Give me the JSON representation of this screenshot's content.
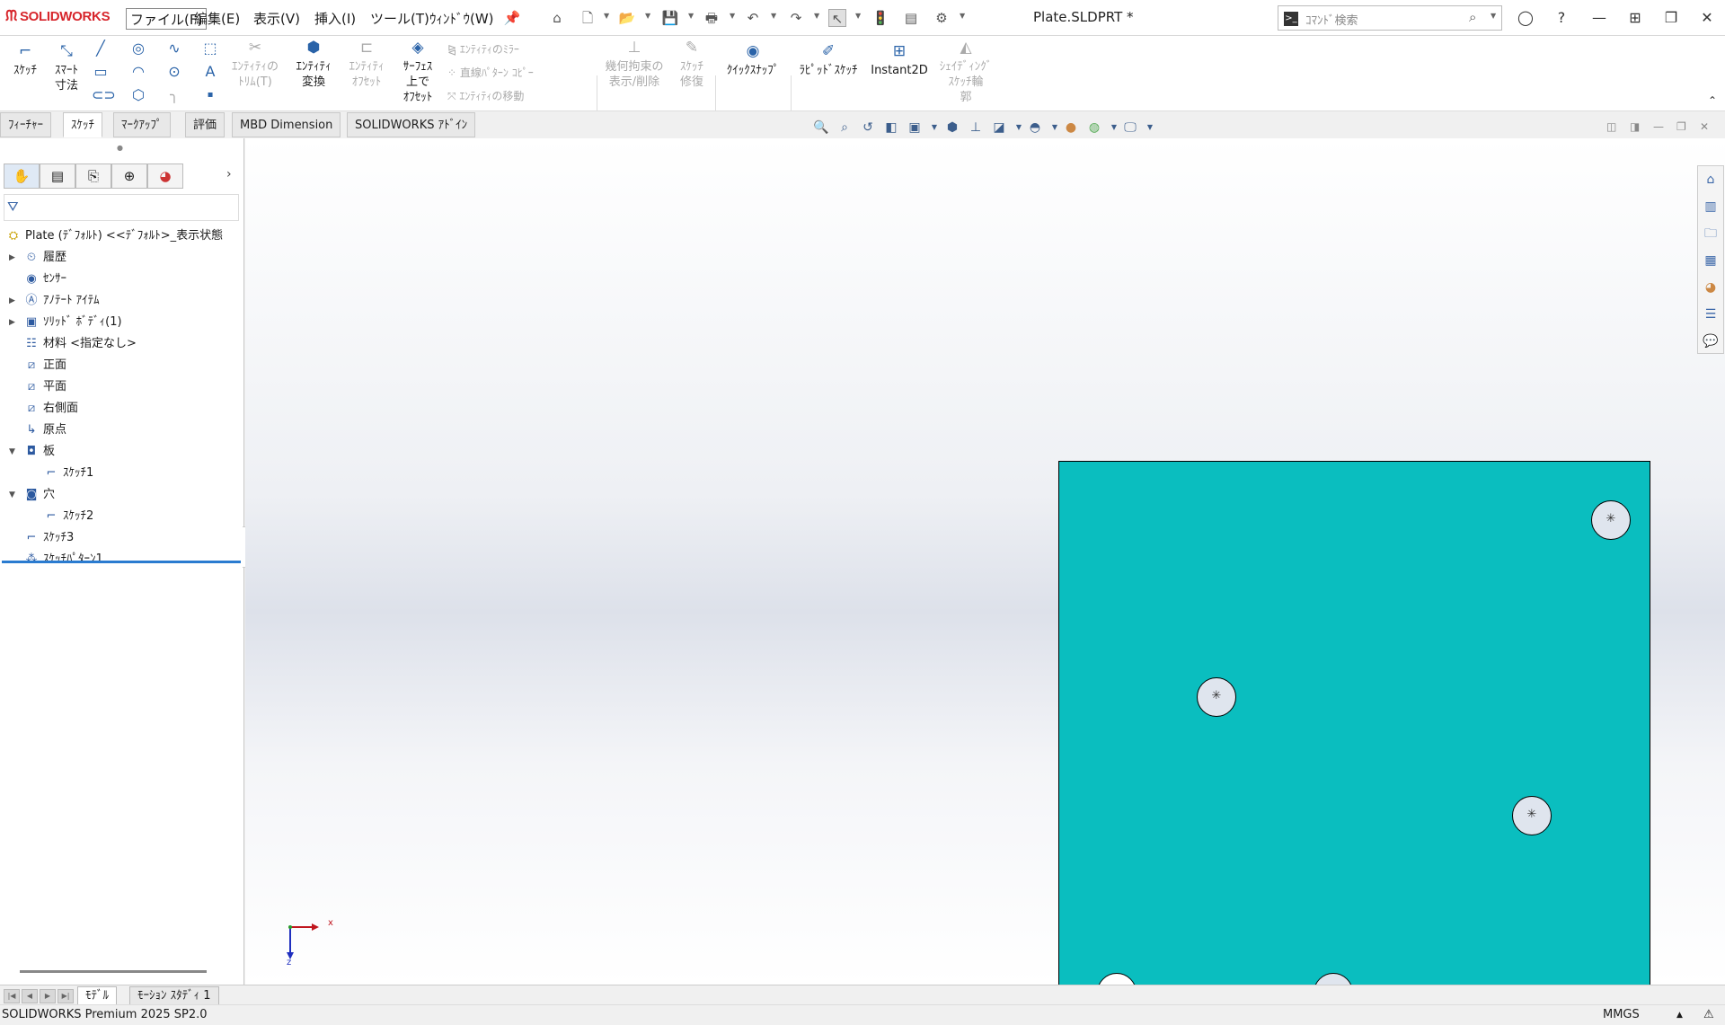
{
  "titlebar": {
    "app_name": "SOLIDWORKS",
    "menus": [
      "ファイル(F)",
      "編集(E)",
      "表示(V)",
      "挿入(I)",
      "ツール(T)",
      "ｳｨﾝﾄﾞｳ(W)"
    ],
    "document_title": "Plate.SLDPRT *",
    "search_placeholder": "ｺﾏﾝﾄﾞ検索"
  },
  "ribbon": {
    "sketch": "ｽｹｯﾁ",
    "smart_dim_1": "ｽﾏｰﾄ",
    "smart_dim_2": "寸法",
    "trim_1": "ｴﾝﾃｨﾃｨの",
    "trim_2": "ﾄﾘﾑ(T)",
    "convert_1": "ｴﾝﾃｨﾃｨ",
    "convert_2": "変換",
    "offset_1": "ｴﾝﾃｨﾃｨ",
    "offset_2": "ｵﾌｾｯﾄ",
    "surf_offset_1": "ｻｰﾌｪｽ",
    "surf_offset_2": "上で",
    "surf_offset_3": "ｵﾌｾｯﾄ",
    "mirror": "ｴﾝﾃｨﾃｨのﾐﾗｰ",
    "linear_pattern": "直線ﾊﾟﾀｰﾝ ｺﾋﾟｰ",
    "move": "ｴﾝﾃｨﾃｨの移動",
    "relations_1": "幾何拘束の",
    "relations_2": "表示/削除",
    "repair_1": "ｽｹｯﾁ",
    "repair_2": "修復",
    "quick_snaps": "ｸｲｯｸｽﾅｯﾌﾟ",
    "rapid_sketch": "ﾗﾋﾟｯﾄﾞｽｹｯﾁ",
    "instant2d": "Instant2D",
    "shaded_1": "ｼｪｲﾃﾞｨﾝｸﾞ",
    "shaded_2": "ｽｹｯﾁ輪",
    "shaded_3": "郭"
  },
  "command_tabs": [
    {
      "label": "ﾌｨｰﾁｬｰ",
      "active": false
    },
    {
      "label": "ｽｹｯﾁ",
      "active": true
    },
    {
      "label": "ﾏｰｸｱｯﾌﾟ",
      "active": false
    },
    {
      "label": "評価",
      "active": false
    },
    {
      "label": "MBD Dimension",
      "active": false
    },
    {
      "label": "SOLIDWORKS ｱﾄﾞｲﾝ",
      "active": false
    }
  ],
  "feature_tree": {
    "root": "Plate (ﾃﾞﾌｫﾙﾄ) <<ﾃﾞﾌｫﾙﾄ>_表示状態",
    "items": [
      {
        "label": "履歴",
        "icon": "history-icon"
      },
      {
        "label": "ｾﾝｻｰ",
        "icon": "sensor-icon"
      },
      {
        "label": "ｱﾉﾃｰﾄ ｱｲﾃﾑ",
        "icon": "annotation-icon"
      },
      {
        "label": "ｿﾘｯﾄﾞ ﾎﾞﾃﾞｨ(1)",
        "icon": "solid-body-icon"
      },
      {
        "label": "材料 <指定なし>",
        "icon": "material-icon"
      },
      {
        "label": "正面",
        "icon": "plane-icon"
      },
      {
        "label": "平面",
        "icon": "plane-icon"
      },
      {
        "label": "右側面",
        "icon": "plane-icon"
      },
      {
        "label": "原点",
        "icon": "origin-icon"
      },
      {
        "label": "板",
        "icon": "extrude-icon"
      },
      {
        "label": "ｽｹｯﾁ1",
        "icon": "sketch-icon"
      },
      {
        "label": "穴",
        "icon": "cut-extrude-icon"
      },
      {
        "label": "ｽｹｯﾁ2",
        "icon": "sketch-icon"
      },
      {
        "label": "ｽｹｯﾁ3",
        "icon": "sketch-icon"
      },
      {
        "label": "ｽｹｯﾁﾊﾟﾀｰﾝ1",
        "icon": "sketch-pattern-icon"
      }
    ]
  },
  "viewport": {
    "part_color": "#0abebf",
    "axis_x": "x",
    "axis_z": "z"
  },
  "bottom_tabs": [
    "ﾓﾃﾞﾙ",
    "ﾓｰｼｮﾝ ｽﾀﾃﾞｨ 1"
  ],
  "status": {
    "version": "SOLIDWORKS Premium 2025 SP2.0",
    "units": "MMGS"
  }
}
